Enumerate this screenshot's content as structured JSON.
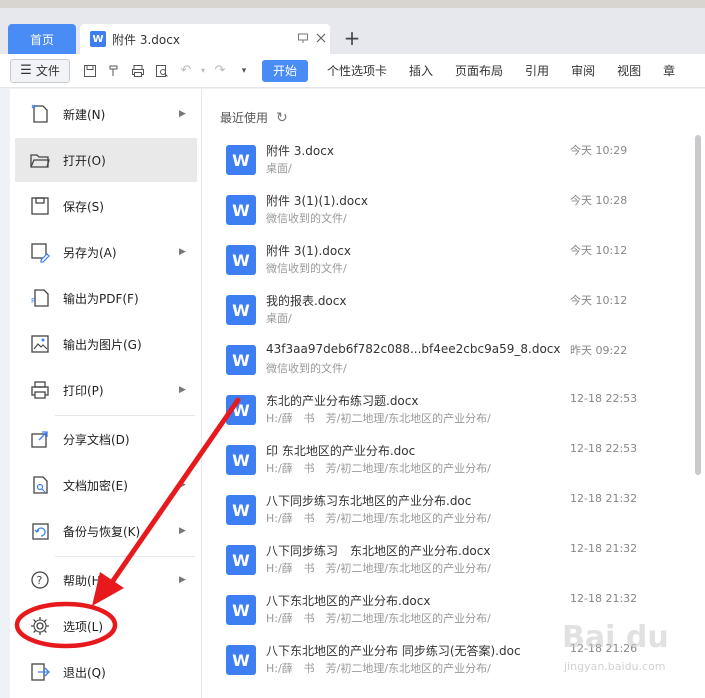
{
  "tabs": {
    "home": "首页",
    "doc_title": "附件 3.docx",
    "add": "+"
  },
  "toolbar": {
    "file_label": "文件",
    "menus": [
      "开始",
      "个性选项卡",
      "插入",
      "页面布局",
      "引用",
      "审阅",
      "视图",
      "章"
    ]
  },
  "file_menu": {
    "items": [
      {
        "label": "新建(N)",
        "icon": "new-doc-icon",
        "submenu": true
      },
      {
        "label": "打开(O)",
        "icon": "folder-open-icon",
        "submenu": false,
        "active": true
      },
      {
        "label": "保存(S)",
        "icon": "save-icon",
        "submenu": false
      },
      {
        "label": "另存为(A)",
        "icon": "save-as-icon",
        "submenu": true
      },
      {
        "label": "输出为PDF(F)",
        "icon": "export-pdf-icon",
        "submenu": false
      },
      {
        "label": "输出为图片(G)",
        "icon": "export-image-icon",
        "submenu": false
      },
      {
        "label": "打印(P)",
        "icon": "print-icon",
        "submenu": true
      },
      {
        "label": "分享文档(D)",
        "icon": "share-icon",
        "submenu": false
      },
      {
        "label": "文档加密(E)",
        "icon": "encrypt-icon",
        "submenu": true
      },
      {
        "label": "备份与恢复(K)",
        "icon": "backup-icon",
        "submenu": true
      },
      {
        "label": "帮助(H)",
        "icon": "help-icon",
        "submenu": true
      },
      {
        "label": "选项(L)",
        "icon": "gear-icon",
        "submenu": false
      },
      {
        "label": "退出(Q)",
        "icon": "exit-icon",
        "submenu": false
      }
    ]
  },
  "recent": {
    "header": "最近使用",
    "files": [
      {
        "name": "附件 3.docx",
        "path": "桌面/",
        "time": "今天 10:29"
      },
      {
        "name": "附件 3(1)(1).docx",
        "path": "微信收到的文件/",
        "time": "今天 10:28"
      },
      {
        "name": "附件 3(1).docx",
        "path": "微信收到的文件/",
        "time": "今天 10:12"
      },
      {
        "name": "我的报表.docx",
        "path": "桌面/",
        "time": "今天 10:12"
      },
      {
        "name": "43f3aa97deb6f782c088...bf4ee2cbc9a59_8.docx",
        "path": "微信收到的文件/",
        "time": "昨天 09:22"
      },
      {
        "name": "东北的产业分布练习题.docx",
        "path": "H:/薛　书　芳/初二地理/东北地区的产业分布/",
        "time": "12-18 22:53"
      },
      {
        "name": "印 东北地区的产业分布.doc",
        "path": "H:/薛　书　芳/初二地理/东北地区的产业分布/",
        "time": "12-18 22:53"
      },
      {
        "name": "八下同步练习东北地区的产业分布.doc",
        "path": "H:/薛　书　芳/初二地理/东北地区的产业分布/",
        "time": "12-18 21:32"
      },
      {
        "name": "八下同步练习　东北地区的产业分布.docx",
        "path": "H:/薛　书　芳/初二地理/东北地区的产业分布/",
        "time": "12-18 21:32"
      },
      {
        "name": "八下东北地区的产业分布.docx",
        "path": "H:/薛　书　芳/初二地理/东北地区的产业分布/",
        "time": "12-18 21:32"
      },
      {
        "name": "八下东北地区的产业分布 同步练习(无答案).doc",
        "path": "H:/薛　书　芳/初二地理/东北地区的产业分布/",
        "time": "12-18 21:26"
      }
    ]
  },
  "watermark": {
    "text": "Bai du",
    "sub": "jingyan.baidu.com"
  },
  "colors": {
    "accent": "#4a8cf5",
    "word_blue": "#3d7ff2",
    "annotation_red": "#e8191c"
  }
}
